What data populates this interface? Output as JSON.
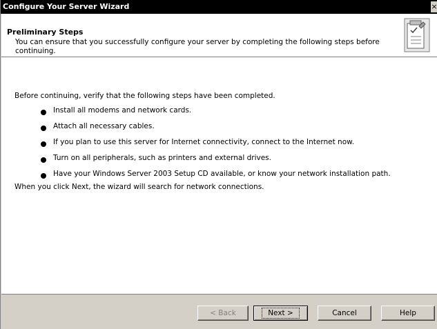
{
  "window": {
    "title": "Configure Your Server Wizard",
    "close_label": "×"
  },
  "header": {
    "title": "Preliminary Steps",
    "subtitle": "You can ensure that you successfully configure your server by completing the following steps before continuing.",
    "icon": "checklist-icon"
  },
  "main": {
    "intro": "Before continuing, verify that the following steps have been completed.",
    "steps": [
      "Install all modems and network cards.",
      "Attach all necessary cables.",
      "If you plan to use this server for Internet connectivity, connect to the Internet now.",
      "Turn on all peripherals, such as printers and external drives.",
      "Have your Windows Server 2003 Setup CD available, or know your network installation path."
    ],
    "outro": "When you click Next, the wizard will search for network connections."
  },
  "buttons": {
    "back": "< Back",
    "next": "Next >",
    "cancel": "Cancel",
    "help": "Help"
  }
}
